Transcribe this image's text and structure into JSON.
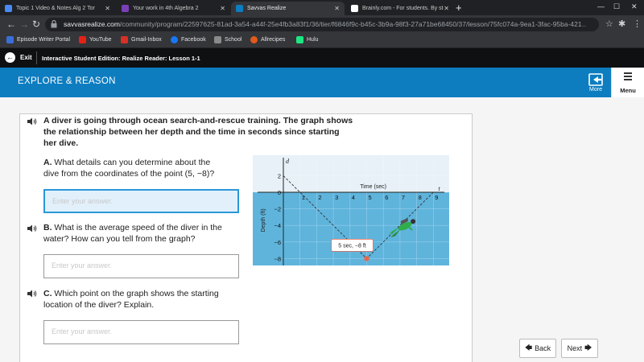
{
  "browser": {
    "tabs": [
      {
        "title": "Topic 1 Video & Notes Alg 2 Tor",
        "color": "#4a8af4"
      },
      {
        "title": "Your work in 4th Algebra 2",
        "color": "#7b3fb8"
      },
      {
        "title": "Savvas Realize",
        "color": "#0d7dc0"
      },
      {
        "title": "Brainly.com - For students. By st",
        "color": "#111111"
      }
    ],
    "new_tab": "+",
    "window_controls": [
      "—",
      "☐",
      "✕"
    ],
    "url_host": "savvasrealize.com",
    "url_path": "/community/program/22597625-81ad-3a54-a44f-25e4fb3a83f1/36/tier/f6846f9c-b45c-3b9a-98f3-27a71be68450/37/lesson/75fc074a-9ea1-3fac-95ba-421…",
    "bookmarks": [
      {
        "label": "Episode Writer Portal",
        "color": "#3b6fd8"
      },
      {
        "label": "YouTube",
        "color": "#e62117"
      },
      {
        "label": "Gmail-Inbox",
        "color": "#d93025"
      },
      {
        "label": "Facebook",
        "color": "#1877f2"
      },
      {
        "label": "School",
        "color": "#8a8a8a"
      },
      {
        "label": "Allrecipes",
        "color": "#e05a1c"
      },
      {
        "label": "Hulu",
        "color": "#1ce783"
      }
    ]
  },
  "app": {
    "exit_label": "Exit",
    "title": "Interactive Student Edition: Realize Reader: Lesson 1-1",
    "header": "EXPLORE & REASON",
    "more_label": "More",
    "menu_label": "Menu",
    "accent": "#0d7dc0"
  },
  "content": {
    "intro_lines": [
      "A diver is going through ocean search-and-rescue training. The graph shows",
      "the relationship between her depth and the time in seconds since starting",
      "her dive."
    ],
    "qA_prefix": "A.",
    "qA_lines": [
      " What details can you determine about the",
      "dive from the coordinates of the point (5, −8)?"
    ],
    "qB_prefix": "B.",
    "qB_lines": [
      " What is the average speed of the diver in the",
      "water? How can you tell from the graph?"
    ],
    "qC_prefix": "C.",
    "qC_lines": [
      " Which point on the graph shows the starting",
      "location of the diver? Explain."
    ],
    "answer_placeholder": "Enter your answer."
  },
  "graph": {
    "y_axis_letter": "d",
    "t_axis_letter": "t",
    "x_label": "Time (sec)",
    "y_label": "Depth (ft)",
    "x_ticks": [
      "1",
      "2",
      "3",
      "4",
      "5",
      "6",
      "7",
      "8",
      "9"
    ],
    "y_ticks": [
      "2",
      "0",
      "−2",
      "−4",
      "−6",
      "−8"
    ],
    "point_label": "5 sec, −8 ft",
    "points": [
      {
        "x": 1,
        "y": 0
      },
      {
        "x": 5,
        "y": -8
      },
      {
        "x": 9,
        "y": 0
      }
    ],
    "water_color": "#5fb4dc",
    "sky_color": "#e8f1f7"
  },
  "footer": {
    "back_label": "Back",
    "next_label": "Next"
  }
}
